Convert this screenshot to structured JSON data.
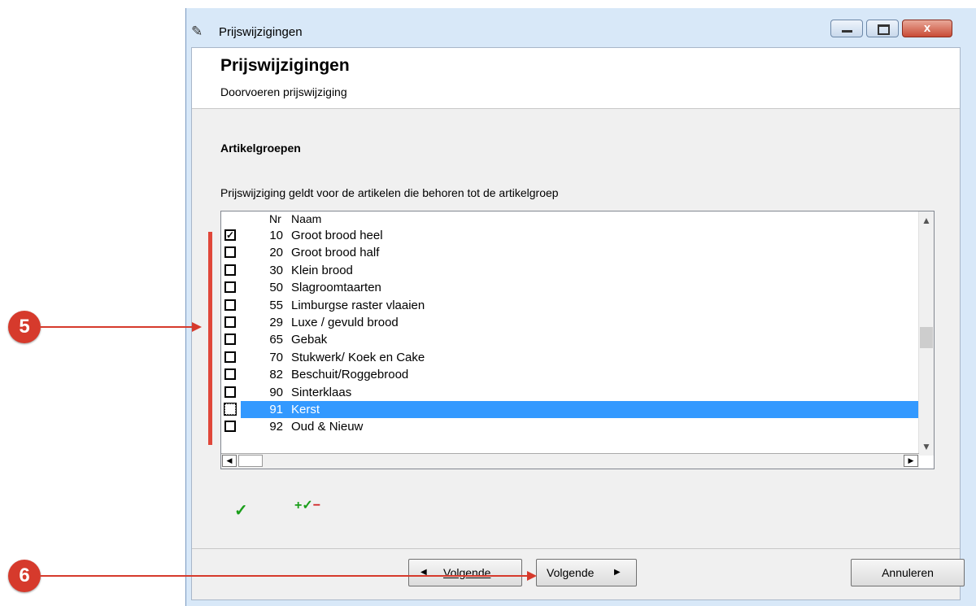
{
  "window": {
    "title": "Prijswijzigingen",
    "close_label": "x"
  },
  "header": {
    "title": "Prijswijzigingen",
    "subtitle": "Doorvoeren prijswijziging"
  },
  "section": {
    "title": "Artikelgroepen",
    "description": "Prijswijziging geldt voor de artikelen die behoren tot de artikelgroep"
  },
  "list": {
    "columns": {
      "nr": "Nr",
      "naam": "Naam"
    },
    "rows": [
      {
        "nr": "10",
        "naam": "Groot brood heel",
        "checked": true
      },
      {
        "nr": "20",
        "naam": "Groot brood half",
        "checked": false
      },
      {
        "nr": "30",
        "naam": "Klein brood",
        "checked": false
      },
      {
        "nr": "50",
        "naam": "Slagroomtaarten",
        "checked": false
      },
      {
        "nr": "55",
        "naam": "Limburgse raster vlaaien",
        "checked": false
      },
      {
        "nr": "29",
        "naam": "Luxe / gevuld brood",
        "checked": false
      },
      {
        "nr": "65",
        "naam": "Gebak",
        "checked": false
      },
      {
        "nr": "70",
        "naam": "Stukwerk/ Koek en Cake",
        "checked": false
      },
      {
        "nr": "82",
        "naam": "Beschuit/Roggebrood",
        "checked": false
      },
      {
        "nr": "90",
        "naam": "Sinterklaas",
        "checked": false
      },
      {
        "nr": "91",
        "naam": "Kerst",
        "checked": false,
        "selected": true
      },
      {
        "nr": "92",
        "naam": "Oud & Nieuw",
        "checked": false
      }
    ]
  },
  "toolbar": {
    "check_all_icon": "check-all-icon",
    "toggle_icon": "toggle-selection-icon"
  },
  "footer": {
    "prev_label": "Volgende",
    "next_label": "Volgende",
    "cancel_label": "Annuleren"
  },
  "annotations": {
    "callout_5": "5",
    "callout_6": "6"
  },
  "colors": {
    "selection": "#3399ff",
    "callout": "#d63a2c",
    "check_green": "#1a9e1a"
  }
}
